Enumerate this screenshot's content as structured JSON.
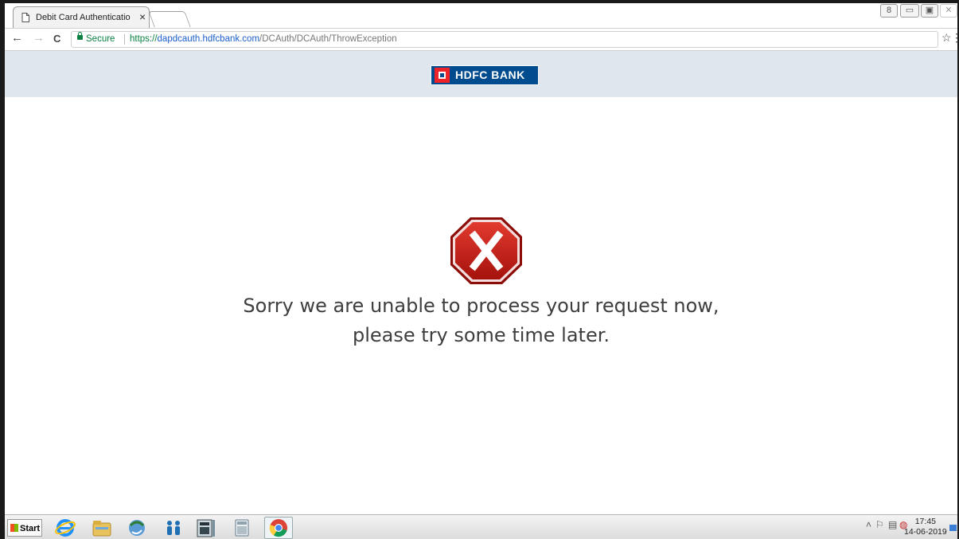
{
  "browser": {
    "tab_title": "Debit Card Authenticatio",
    "tab_close": "×",
    "window_controls": [
      "8",
      "▭",
      "▣",
      "✕"
    ],
    "nav": {
      "back": "←",
      "forward": "→",
      "reload": "C"
    },
    "security_label": "Secure",
    "url_scheme": "https://",
    "url_host": "dapdcauth.hdfcbank.com",
    "url_path": "/DCAuth/DCAuth/ThrowException",
    "star": "☆",
    "menu": "⋮"
  },
  "page": {
    "logo_text": "HDFC BANK",
    "brand_colors": {
      "blue": "#004c8f",
      "red": "#ed232a",
      "header_bg": "#dfe6ed"
    },
    "error_icon": "stop-error-icon",
    "message_line1": "Sorry we are unable to process your request now,",
    "message_line2": "please try some time later."
  },
  "taskbar": {
    "start_label": "Start",
    "apps": [
      "internet-explorer-icon",
      "file-explorer-icon",
      "network-icon",
      "people-icon",
      "calculator-grid-icon",
      "calculator-icon",
      "chrome-icon"
    ],
    "tray_icons": [
      "chevron-up-icon",
      "flag-icon",
      "network-tray-icon",
      "volume-muted-icon"
    ],
    "time": "17:45",
    "date": "14-06-2019"
  }
}
